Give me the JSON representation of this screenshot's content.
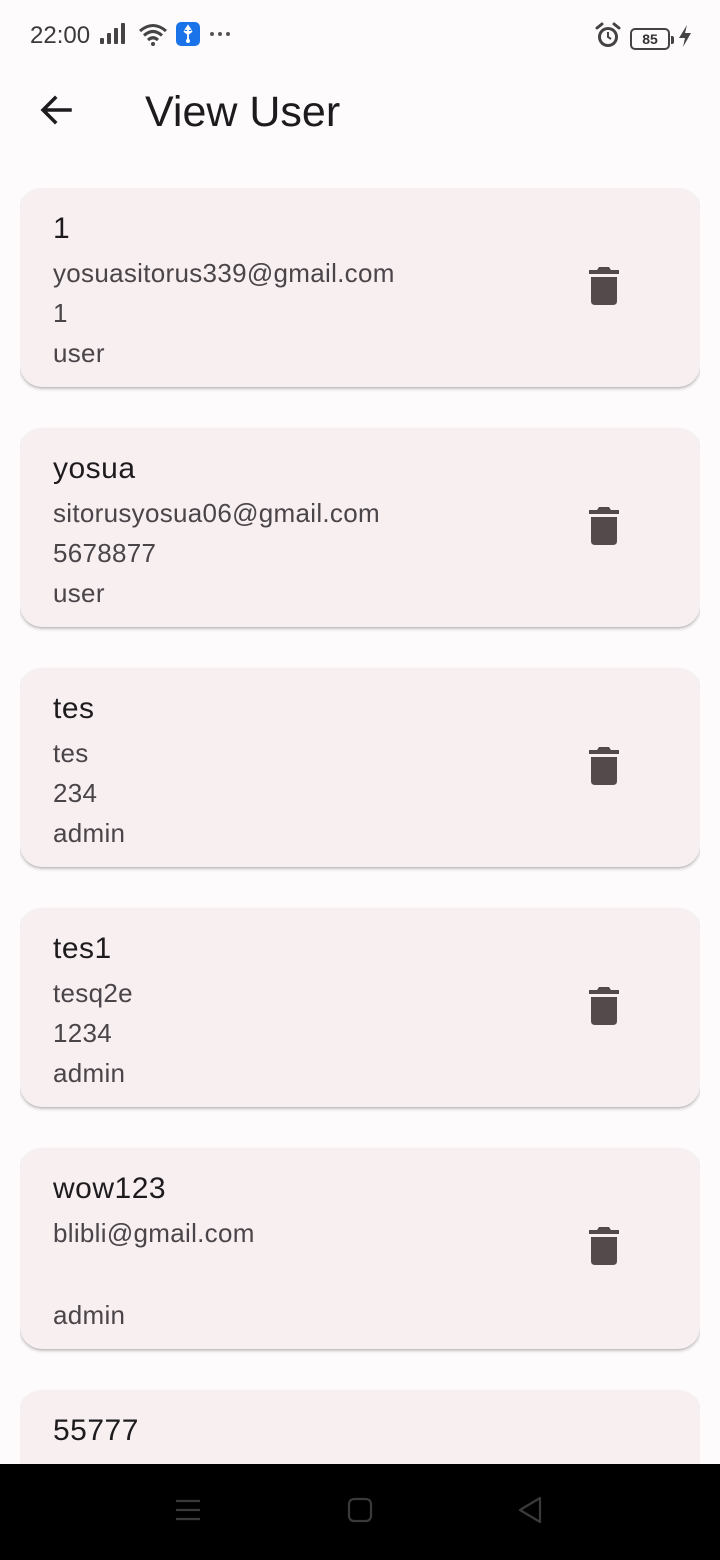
{
  "status_bar": {
    "time": "22:00",
    "left_icons": [
      "signal-icon",
      "wifi-icon",
      "usb-icon",
      "more-icon"
    ],
    "right_icons": [
      "alarm-icon",
      "battery-icon",
      "charging-icon"
    ],
    "battery_level": "85"
  },
  "app_bar": {
    "title": "View User",
    "back_icon": "arrow-back-icon"
  },
  "users": [
    {
      "name": "1",
      "email": "yosuasitorus339@gmail.com",
      "phone": "1",
      "role": "user"
    },
    {
      "name": "yosua",
      "email": "sitorusyosua06@gmail.com",
      "phone": "5678877",
      "role": "user"
    },
    {
      "name": "tes",
      "email": "tes",
      "phone": "234",
      "role": "admin"
    },
    {
      "name": "tes1",
      "email": "tesq2e",
      "phone": "1234",
      "role": "admin"
    },
    {
      "name": "wow123",
      "email": "blibli@gmail.com",
      "phone": "",
      "role": "admin"
    },
    {
      "name": "55777",
      "email": "",
      "phone": "",
      "role": ""
    }
  ],
  "card_action_icon": "delete-icon",
  "nav_bar": {
    "buttons": [
      "menu-icon",
      "home-icon",
      "back-icon"
    ]
  },
  "colors": {
    "background": "#fefbfc",
    "card": "#f8eff1",
    "delete_icon": "#544a4b",
    "nav_bar": "#000000"
  }
}
